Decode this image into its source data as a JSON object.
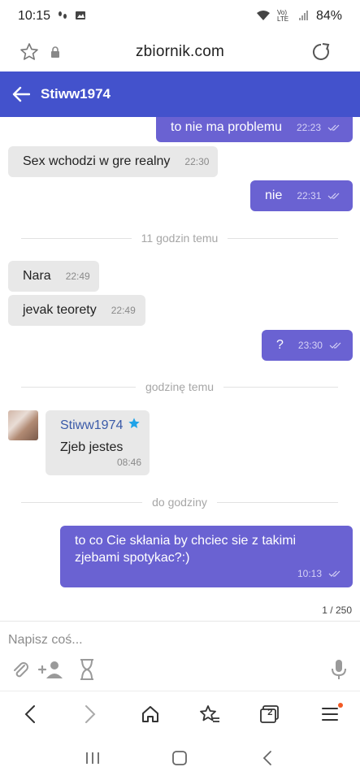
{
  "status_bar": {
    "time": "10:15",
    "battery": "84%",
    "network": "Vo) LTE"
  },
  "browser": {
    "domain": "zbiornik.com"
  },
  "chat_header": {
    "contact": "Stiww1974"
  },
  "messages": [
    {
      "dir": "out",
      "text": "to nie ma problemu",
      "time": "22:23"
    },
    {
      "dir": "in",
      "text": "Sex wchodzi w gre realny",
      "time": "22:30"
    },
    {
      "dir": "out",
      "text": "nie",
      "time": "22:31"
    },
    {
      "dir": "in",
      "text": "Nara",
      "time": "22:49"
    },
    {
      "dir": "in",
      "text": "jevak teorety",
      "time": "22:49"
    },
    {
      "dir": "out",
      "text": "?",
      "time": "23:30"
    },
    {
      "dir": "in",
      "author": "Stiww1974",
      "text": "Zjeb jestes",
      "time": "08:46"
    },
    {
      "dir": "out",
      "text_line1": "to co Cie skłania by chciec sie z takimi",
      "text_line2": "zjebami spotykac?:)",
      "time": "10:13"
    }
  ],
  "dividers": [
    "11 godzin temu",
    "godzinę temu",
    "do godziny"
  ],
  "counter": "1 / 250",
  "input": {
    "placeholder": "Napisz coś..."
  },
  "tabs_count": "2",
  "colors": {
    "header": "#4352cc",
    "outgoing_bubble": "#6a62d2",
    "incoming_bubble": "#e8e8e8"
  }
}
